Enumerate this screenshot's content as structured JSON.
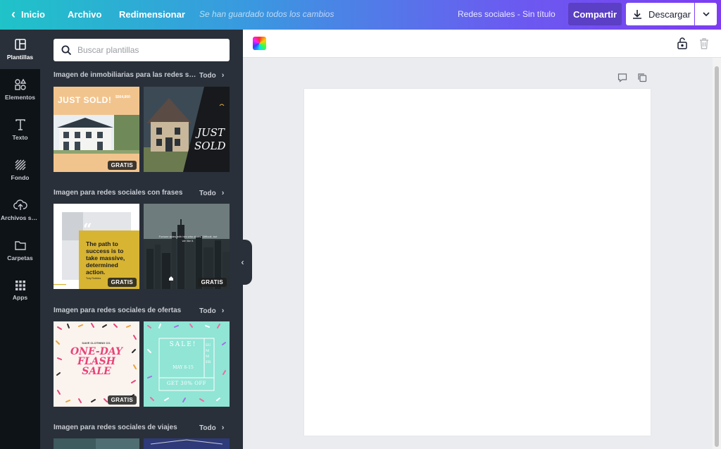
{
  "topbar": {
    "home_label": "Inicio",
    "file_label": "Archivo",
    "resize_label": "Redimensionar",
    "save_status": "Se han guardado todos los cambios",
    "document_title": "Redes sociales - Sin título",
    "share_label": "Compartir",
    "download_label": "Descargar"
  },
  "sidebar": {
    "items": [
      {
        "label": "Plantillas",
        "icon": "templates-icon"
      },
      {
        "label": "Elementos",
        "icon": "elements-icon"
      },
      {
        "label": "Texto",
        "icon": "text-icon"
      },
      {
        "label": "Fondo",
        "icon": "background-icon"
      },
      {
        "label": "Archivos su...",
        "icon": "upload-icon"
      },
      {
        "label": "Carpetas",
        "icon": "folder-icon"
      },
      {
        "label": "Apps",
        "icon": "apps-icon"
      }
    ]
  },
  "panel": {
    "search_placeholder": "Buscar plantillas",
    "sections": [
      {
        "title": "Imagen de inmobiliarias para las redes so...",
        "all": "Todo"
      },
      {
        "title": "Imagen para redes sociales con frases",
        "all": "Todo"
      },
      {
        "title": "Imagen para redes sociales de ofertas",
        "all": "Todo"
      },
      {
        "title": "Imagen para redes sociales de viajes",
        "all": "Todo"
      }
    ],
    "badge": "GRATIS",
    "templates": {
      "just_sold_1": {
        "headline": "JUST SOLD!",
        "price": "$564,800"
      },
      "just_sold_2": {
        "line1": "JUST",
        "line2": "SOLD"
      },
      "quote": {
        "text": "The path to success is to take massive, determined action.",
        "author": "Tony Robbins"
      },
      "city": {
        "text": "Fortune sides with him who dares. Difficult, but we like it."
      },
      "flash": {
        "brand": "DAVE CLOTHING CO.",
        "headline": "ONE-DAY FLASH SALE"
      },
      "summer": {
        "sale": "SALE!",
        "date": "MAY 8-15",
        "offer": "GET 30% OFF",
        "side": "SUMMER"
      }
    }
  },
  "colors": {
    "rail_bg": "#0e1318",
    "panel_bg": "#293039",
    "share_bg": "#5b3fc4",
    "canvas_bg": "#ebecf0"
  }
}
